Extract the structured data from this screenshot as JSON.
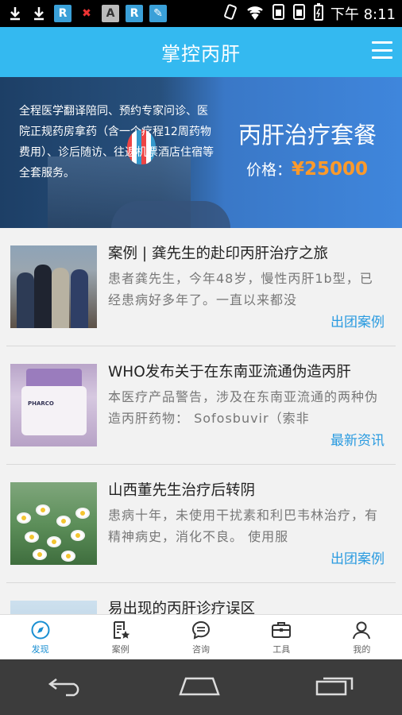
{
  "status_bar": {
    "time": "下午 8:11",
    "left_icons": [
      "download-icon",
      "download-icon",
      "r-app-icon",
      "gift-icon",
      "a-app-icon",
      "r-app-icon",
      "feather-icon"
    ],
    "right_icons": [
      "vibrate-icon",
      "wifi-icon",
      "sim-icon",
      "sim-icon",
      "battery-charging-icon"
    ]
  },
  "header": {
    "title": "掌控丙肝",
    "menu_icon": "menu-icon"
  },
  "banner": {
    "description": "全程医学翻译陪同、预约专家问诊、医院正规药房拿药（含一个疗程12周药物费用）、诊后随访、往返机票酒店住宿等全套服务。",
    "package_title": "丙肝治疗套餐",
    "price_label": "价格：",
    "price_value": "¥25000"
  },
  "articles": [
    {
      "title": "案例 | 龚先生的赴印丙肝治疗之旅",
      "description": "患者龚先生，今年48岁，慢性丙肝1b型，已经患病好多年了。一直以来都没",
      "tag": "出团案例"
    },
    {
      "title": "WHO发布关于在东南亚流通伪造丙肝",
      "description": "本医疗产品警告，涉及在东南亚流通的两种伪造丙肝药物： Sofosbuvir（索非",
      "tag": "最新资讯",
      "thumb_text": "PHARCO"
    },
    {
      "title": "山西董先生治疗后转阴",
      "description": "患病十年，未使用干扰素和利巴韦林治疗，有精神病史，消化不良。 使用服",
      "tag": "出团案例"
    },
    {
      "title": "易出现的丙肝诊疗误区",
      "description": "",
      "tag": ""
    }
  ],
  "tabs": [
    {
      "label": "发现",
      "icon": "compass-icon",
      "active": true
    },
    {
      "label": "案例",
      "icon": "document-star-icon",
      "active": false
    },
    {
      "label": "咨询",
      "icon": "chat-bubble-icon",
      "active": false
    },
    {
      "label": "工具",
      "icon": "briefcase-icon",
      "active": false
    },
    {
      "label": "我的",
      "icon": "person-icon",
      "active": false
    }
  ],
  "nav": {
    "icons": [
      "back-icon",
      "home-icon",
      "recents-icon"
    ]
  },
  "colors": {
    "header": "#34b9f0",
    "accent": "#2a9be0",
    "price": "#ff9a2a"
  }
}
